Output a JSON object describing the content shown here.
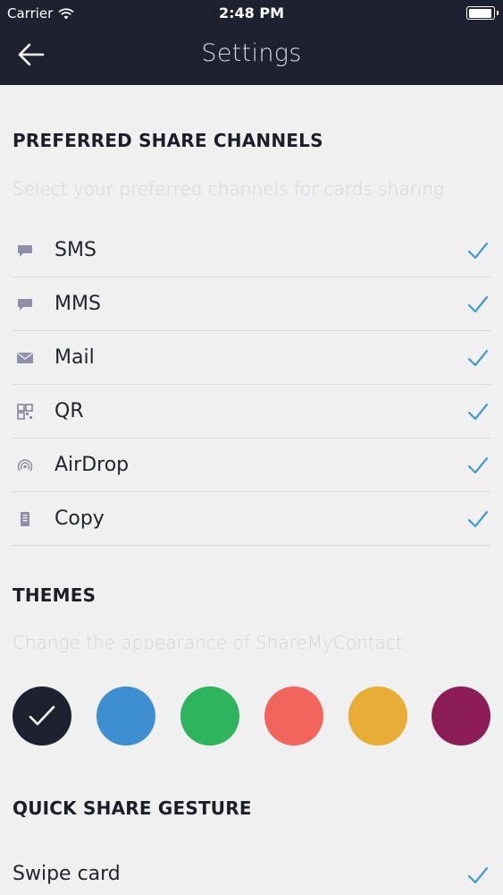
{
  "status_bar": {
    "carrier": "Carrier",
    "time": "2:48 PM"
  },
  "nav": {
    "title": "Settings"
  },
  "share_channels": {
    "title": "PREFERRED SHARE CHANNELS",
    "subtitle": "Select your preferred channels for cards sharing",
    "items": [
      {
        "label": "SMS",
        "icon": "chat-bubble-icon",
        "checked": true
      },
      {
        "label": "MMS",
        "icon": "chat-bubble-icon",
        "checked": true
      },
      {
        "label": "Mail",
        "icon": "envelope-icon",
        "checked": true
      },
      {
        "label": "QR",
        "icon": "qr-code-icon",
        "checked": true
      },
      {
        "label": "AirDrop",
        "icon": "airdrop-icon",
        "checked": true
      },
      {
        "label": "Copy",
        "icon": "clipboard-icon",
        "checked": true
      }
    ]
  },
  "themes": {
    "title": "THEMES",
    "subtitle": "Change the appearance of ShareMyContact",
    "colors": [
      "#1e2230",
      "#3d8fd1",
      "#2db45c",
      "#f2655c",
      "#e8ad36",
      "#8c1d56"
    ],
    "selected_index": 0
  },
  "gesture": {
    "title": "QUICK SHARE GESTURE",
    "option_label": "Swipe card",
    "checked": true
  },
  "colors": {
    "accent": "#3d9bd0",
    "icon_gray": "#8d90a8",
    "header_bg": "#1e2230"
  }
}
